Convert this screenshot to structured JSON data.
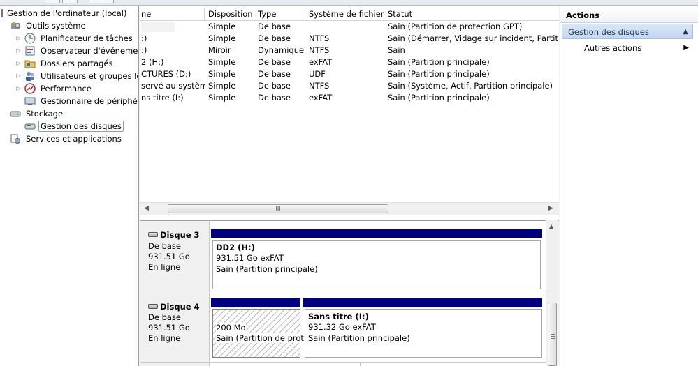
{
  "tree": {
    "root": "Gestion de l'ordinateur (local)",
    "system_tools": "Outils système",
    "items": [
      {
        "label": "Planificateur de tâches",
        "icon": "clock-icon"
      },
      {
        "label": "Observateur d'événements",
        "icon": "event-viewer-icon"
      },
      {
        "label": "Dossiers partagés",
        "icon": "shared-folder-icon"
      },
      {
        "label": "Utilisateurs et groupes loca",
        "icon": "users-icon"
      },
      {
        "label": "Performance",
        "icon": "performance-icon"
      },
      {
        "label": "Gestionnaire de périphériq",
        "icon": "device-manager-icon"
      }
    ],
    "storage": "Stockage",
    "disk_management": "Gestion des disques",
    "services": "Services et applications"
  },
  "volumes": {
    "columns": [
      "ne",
      "Disposition",
      "Type",
      "Système de fichiers",
      "Statut"
    ],
    "rows": [
      [
        "",
        "Simple",
        "De base",
        "",
        "Sain (Partition de protection GPT)"
      ],
      [
        ":)",
        "Simple",
        "De base",
        "NTFS",
        "Sain (Démarrer, Vidage sur incident, Partition p"
      ],
      [
        ":)",
        "Miroir",
        "Dynamique",
        "NTFS",
        "Sain"
      ],
      [
        "2 (H:)",
        "Simple",
        "De base",
        "exFAT",
        "Sain (Partition principale)"
      ],
      [
        "CTURES (D:)",
        "Simple",
        "De base",
        "UDF",
        "Sain (Partition principale)"
      ],
      [
        "servé au système",
        "Simple",
        "De base",
        "NTFS",
        "Sain (Système, Actif, Partition principale)"
      ],
      [
        "ns titre  (I:)",
        "Simple",
        "De base",
        "exFAT",
        "Sain (Partition principale)"
      ]
    ],
    "scroll_thumb": "III"
  },
  "disks": [
    {
      "name": "Disque 3",
      "type": "De base",
      "size": "931.51 Go",
      "status": "En ligne",
      "partitions": [
        {
          "title": "DD2  (H:)",
          "size": "931.51 Go exFAT",
          "status": "Sain (Partition principale)"
        }
      ]
    },
    {
      "name": "Disque 4",
      "type": "De base",
      "size": "931.51 Go",
      "status": "En ligne",
      "partitions": [
        {
          "title": "",
          "size": "200 Mo",
          "status": "Sain (Partition de prot"
        },
        {
          "title": "Sans titre   (I:)",
          "size": "931.32 Go exFAT",
          "status": "Sain (Partition principale)"
        }
      ]
    }
  ],
  "actions": {
    "title": "Actions",
    "section": "Gestion des disques",
    "more": "Autres actions"
  }
}
